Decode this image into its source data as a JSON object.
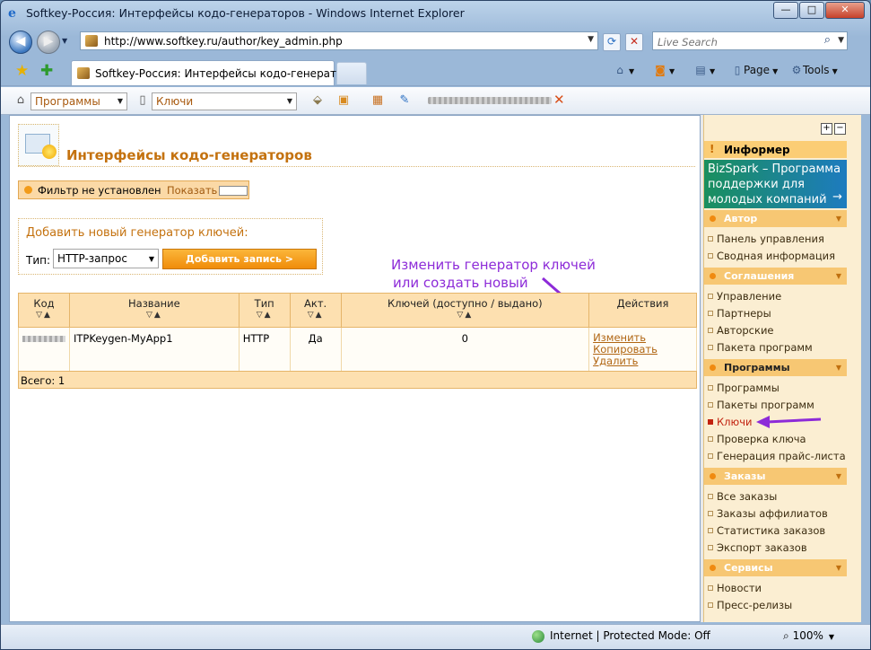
{
  "window": {
    "title": "Softkey-Россия: Интерфейсы кодо-генераторов - Windows Internet Explorer",
    "buttons": {
      "minimize": "—",
      "maximize": "□",
      "close": "✕"
    }
  },
  "address_bar": {
    "url": "http://www.softkey.ru/author/key_admin.php",
    "search_placeholder": "Live Search"
  },
  "tab": {
    "label": "Softkey-Россия: Интерфейсы кодо-генераторов"
  },
  "command_bar": {
    "page_label": "Page",
    "tools_label": "Tools"
  },
  "site_toolbar": {
    "programs_select": "Программы",
    "keys_select": "Ключи"
  },
  "page": {
    "title": "Интерфейсы кодо-генераторов",
    "filter_text": "Фильтр не установлен",
    "filter_show": "Показать",
    "add_header": "Добавить новый генератор ключей:",
    "type_label": "Тип:",
    "type_value": "HTTP-запрос",
    "add_button": "Добавить запись >",
    "annotation_line1": "Изменить генератор ключей",
    "annotation_line2": "или создать новый",
    "sort_arrows": "▽▲"
  },
  "table": {
    "headers": [
      "Код",
      "Название",
      "Тип",
      "Акт.",
      "Ключей (доступно / выдано)",
      "Действия"
    ],
    "rows": [
      {
        "name": "ITPKeygen-MyApp1",
        "type": "HTTP",
        "active": "Да",
        "keys": "0",
        "actions": [
          "Изменить",
          "Копировать",
          "Удалить"
        ]
      }
    ],
    "total": "Всего: 1"
  },
  "sidebar": {
    "informer": "Информер",
    "banner": "BizSpark – Программа поддержки для молодых компаний",
    "banner_arrow": "→",
    "sections": [
      {
        "title": "Автор",
        "items": [
          "Панель управления",
          "Сводная информация"
        ]
      },
      {
        "title": "Соглашения",
        "items": [
          "Управление",
          "Партнеры",
          "Авторские",
          "Пакета программ"
        ]
      },
      {
        "title": "Программы",
        "items": [
          "Программы",
          "Пакеты программ",
          "Ключи",
          "Проверка ключа",
          "Генерация прайс-листа"
        ]
      },
      {
        "title": "Заказы",
        "items": [
          "Все заказы",
          "Заказы аффилиатов",
          "Статистика заказов",
          "Экспорт заказов"
        ]
      },
      {
        "title": "Сервисы",
        "items": [
          "Новости",
          "Пресс-релизы"
        ]
      }
    ]
  },
  "status_bar": {
    "zone": "Internet | Protected Mode: Off",
    "zoom": "100%"
  },
  "colors": {
    "accent_orange": "#f08c0a",
    "title_orange": "#c4720f",
    "annotation_purple": "#8d2bd8",
    "active_red": "#c2220f"
  }
}
